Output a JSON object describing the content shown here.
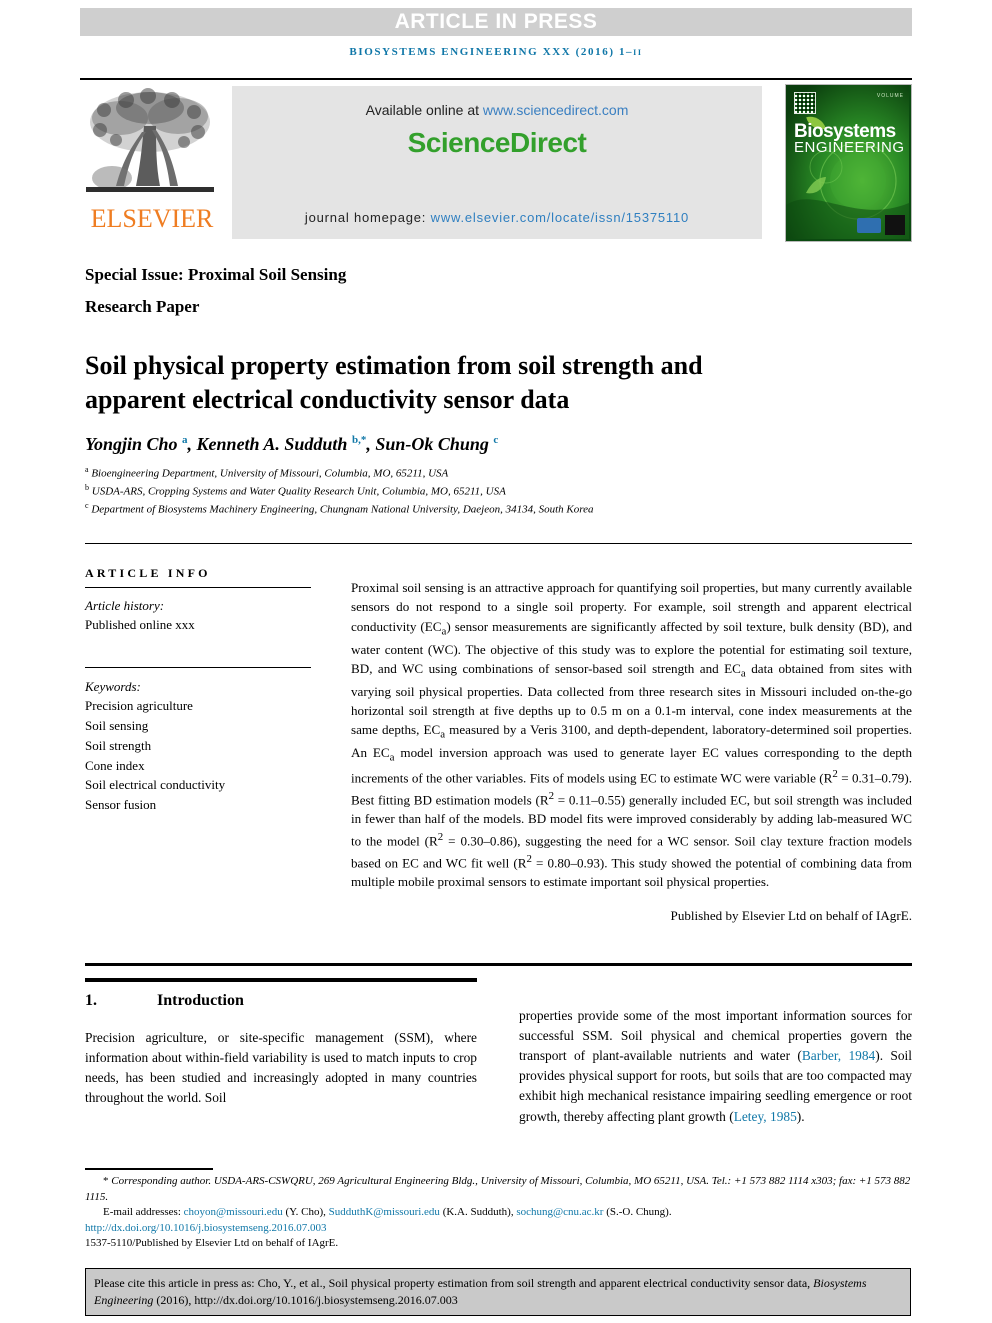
{
  "banner": {
    "article_in_press": "ARTICLE IN PRESS",
    "journal_ref": "BIOSYSTEMS ENGINEERING XXX (2016) 1–ıı"
  },
  "masthead": {
    "publisher_name": "ELSEVIER",
    "available_prefix": "Available online at ",
    "available_link": "www.sciencedirect.com",
    "sciencedirect_logo": "ScienceDirect",
    "homepage_prefix": "journal homepage: ",
    "homepage_link": "www.elsevier.com/locate/issn/15375110",
    "cover_title_line1": "Biosystems",
    "cover_title_line2": "ENGINEERING",
    "cover_volume": "VOLUME"
  },
  "header": {
    "special_issue": "Special Issue: Proximal Soil Sensing",
    "paper_type": "Research Paper",
    "title": "Soil physical property estimation from soil strength and apparent electrical conductivity sensor data"
  },
  "authors": {
    "line": "Yongjin Cho <sup>a</sup>, Kenneth A. Sudduth <sup>b,*</sup>, Sun-Ok Chung <sup>c</sup>",
    "affiliations": [
      "<sup>a</sup> Bioengineering Department, University of Missouri, Columbia, MO, 65211, USA",
      "<sup>b</sup> USDA-ARS, Cropping Systems and Water Quality Research Unit, Columbia, MO, 65211, USA",
      "<sup>c</sup> Department of Biosystems Machinery Engineering, Chungnam National University, Daejeon, 34134, South Korea"
    ]
  },
  "article_info": {
    "heading": "ARTICLE INFO",
    "history_label": "Article history:",
    "history_value": "Published online xxx",
    "keywords_label": "Keywords:",
    "keywords": [
      "Precision agriculture",
      "Soil sensing",
      "Soil strength",
      "Cone index",
      "Soil electrical conductivity",
      "Sensor fusion"
    ]
  },
  "abstract": {
    "text": "Proximal soil sensing is an attractive approach for quantifying soil properties, but many currently available sensors do not respond to a single soil property. For example, soil strength and apparent electrical conductivity (EC<sub>a</sub>) sensor measurements are significantly affected by soil texture, bulk density (BD), and water content (WC). The objective of this study was to explore the potential for estimating soil texture, BD, and WC using combinations of sensor-based soil strength and EC<sub>a</sub> data obtained from sites with varying soil physical properties. Data collected from three research sites in Missouri included on-the-go horizontal soil strength at five depths up to 0.5 m on a 0.1-m interval, cone index measurements at the same depths, EC<sub>a</sub> measured by a Veris 3100, and depth-dependent, laboratory-determined soil properties. An EC<sub>a</sub> model inversion approach was used to generate layer EC values corresponding to the depth increments of the other variables. Fits of models using EC to estimate WC were variable (R<sup>2</sup> = 0.31–0.79). Best fitting BD estimation models (R<sup>2</sup> = 0.11–0.55) generally included EC, but soil strength was included in fewer than half of the models. BD model fits were improved considerably by adding lab-measured WC to the model (R<sup>2</sup> = 0.30–0.86), suggesting the need for a WC sensor. Soil clay texture fraction models based on EC and WC fit well (R<sup>2</sup> = 0.80–0.93). This study showed the potential of combining data from multiple mobile proximal sensors to estimate important soil physical properties.",
    "published_by": "Published by Elsevier Ltd on behalf of IAgrE."
  },
  "introduction": {
    "number": "1.",
    "heading": "Introduction",
    "col_left": "Precision agriculture, or site-specific management (SSM), where information about within-field variability is used to match inputs to crop needs, has been studied and increasingly adopted in many countries throughout the world. Soil",
    "col_right_1": "properties provide some of the most important information sources for successful SSM. Soil physical and chemical properties govern the transport of plant-available nutrients and water (",
    "col_right_cite1": "Barber, 1984",
    "col_right_2": "). Soil provides physical support for roots, but soils that are too compacted may exhibit high mechanical resistance impairing seedling emergence or root growth, thereby affecting plant growth (",
    "col_right_cite2": "Letey, 1985",
    "col_right_3": ")."
  },
  "footnotes": {
    "corresponding_marker": "*",
    "corresponding": "Corresponding author. USDA-ARS-CSWQRU, 269 Agricultural Engineering Bldg., University of Missouri, Columbia, MO 65211, USA. Tel.: +1 573 882 1114 x303; fax: +1 573 882 1115.",
    "email_label": "E-mail addresses:",
    "emails": [
      {
        "address": "choyon@missouri.edu",
        "owner": "(Y. Cho)"
      },
      {
        "address": "SudduthK@missouri.edu",
        "owner": "(K.A. Sudduth)"
      },
      {
        "address": "sochung@cnu.ac.kr",
        "owner": "(S.-O. Chung)"
      }
    ],
    "doi": "http://dx.doi.org/10.1016/j.biosystemseng.2016.07.003",
    "issn_line": "1537-5110/Published by Elsevier Ltd on behalf of IAgrE."
  },
  "citation_box": {
    "text_before_italic": "Please cite this article in press as: Cho, Y., et al., Soil physical property estimation from soil strength and apparent electrical conductivity sensor data, ",
    "italic": "Biosystems Engineering",
    "text_after_italic": " (2016), http://dx.doi.org/10.1016/j.biosystemseng.2016.07.003"
  },
  "colors": {
    "accent_link": "#1178a8",
    "elsevier_orange": "#ef7d22",
    "sciencedirect_green": "#33a02c",
    "banner_gray": "#cfcfcf",
    "cite_box_gray": "#c9c9c9"
  }
}
